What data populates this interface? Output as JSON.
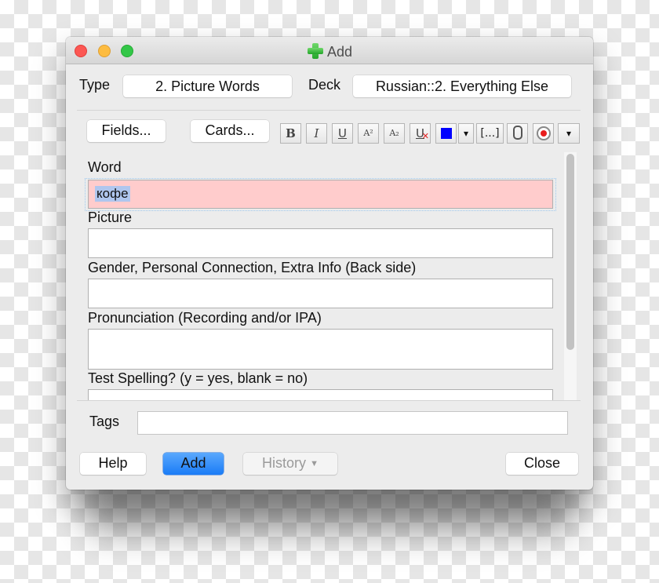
{
  "window": {
    "title": "Add",
    "title_icon": "green-plus-icon"
  },
  "header": {
    "type_label": "Type",
    "type_value": "2. Picture Words",
    "deck_label": "Deck",
    "deck_value": "Russian::2. Everything Else"
  },
  "toolbar": {
    "fields_button": "Fields...",
    "cards_button": "Cards...",
    "format_buttons": [
      {
        "name": "bold",
        "glyph": "B"
      },
      {
        "name": "italic",
        "glyph": "I"
      },
      {
        "name": "underline",
        "glyph": "U"
      },
      {
        "name": "superscript",
        "glyph": "A²"
      },
      {
        "name": "subscript",
        "glyph": "A₂"
      },
      {
        "name": "clear-formatting",
        "glyph": "U"
      },
      {
        "name": "text-color",
        "glyph": ""
      },
      {
        "name": "color-dropdown",
        "glyph": "▾"
      },
      {
        "name": "cloze",
        "glyph": "[...]"
      },
      {
        "name": "attach",
        "glyph": "📎"
      },
      {
        "name": "record",
        "glyph": "●"
      },
      {
        "name": "more",
        "glyph": "▾"
      }
    ],
    "text_color": "#0000ff"
  },
  "fields": [
    {
      "label": "Word",
      "value": "кофе"
    },
    {
      "label": "Picture",
      "value": ""
    },
    {
      "label": "Gender, Personal Connection, Extra Info (Back side)",
      "value": ""
    },
    {
      "label": "Pronunciation (Recording and/or IPA)",
      "value": ""
    },
    {
      "label": "Test Spelling? (y = yes, blank = no)",
      "value": ""
    }
  ],
  "tags": {
    "label": "Tags",
    "value": ""
  },
  "footer": {
    "help_button": "Help",
    "add_button": "Add",
    "history_button": "History",
    "close_button": "Close"
  },
  "colors": {
    "focused_field_bg": "#ffcccc",
    "primary_button": "#1a7cf6"
  }
}
